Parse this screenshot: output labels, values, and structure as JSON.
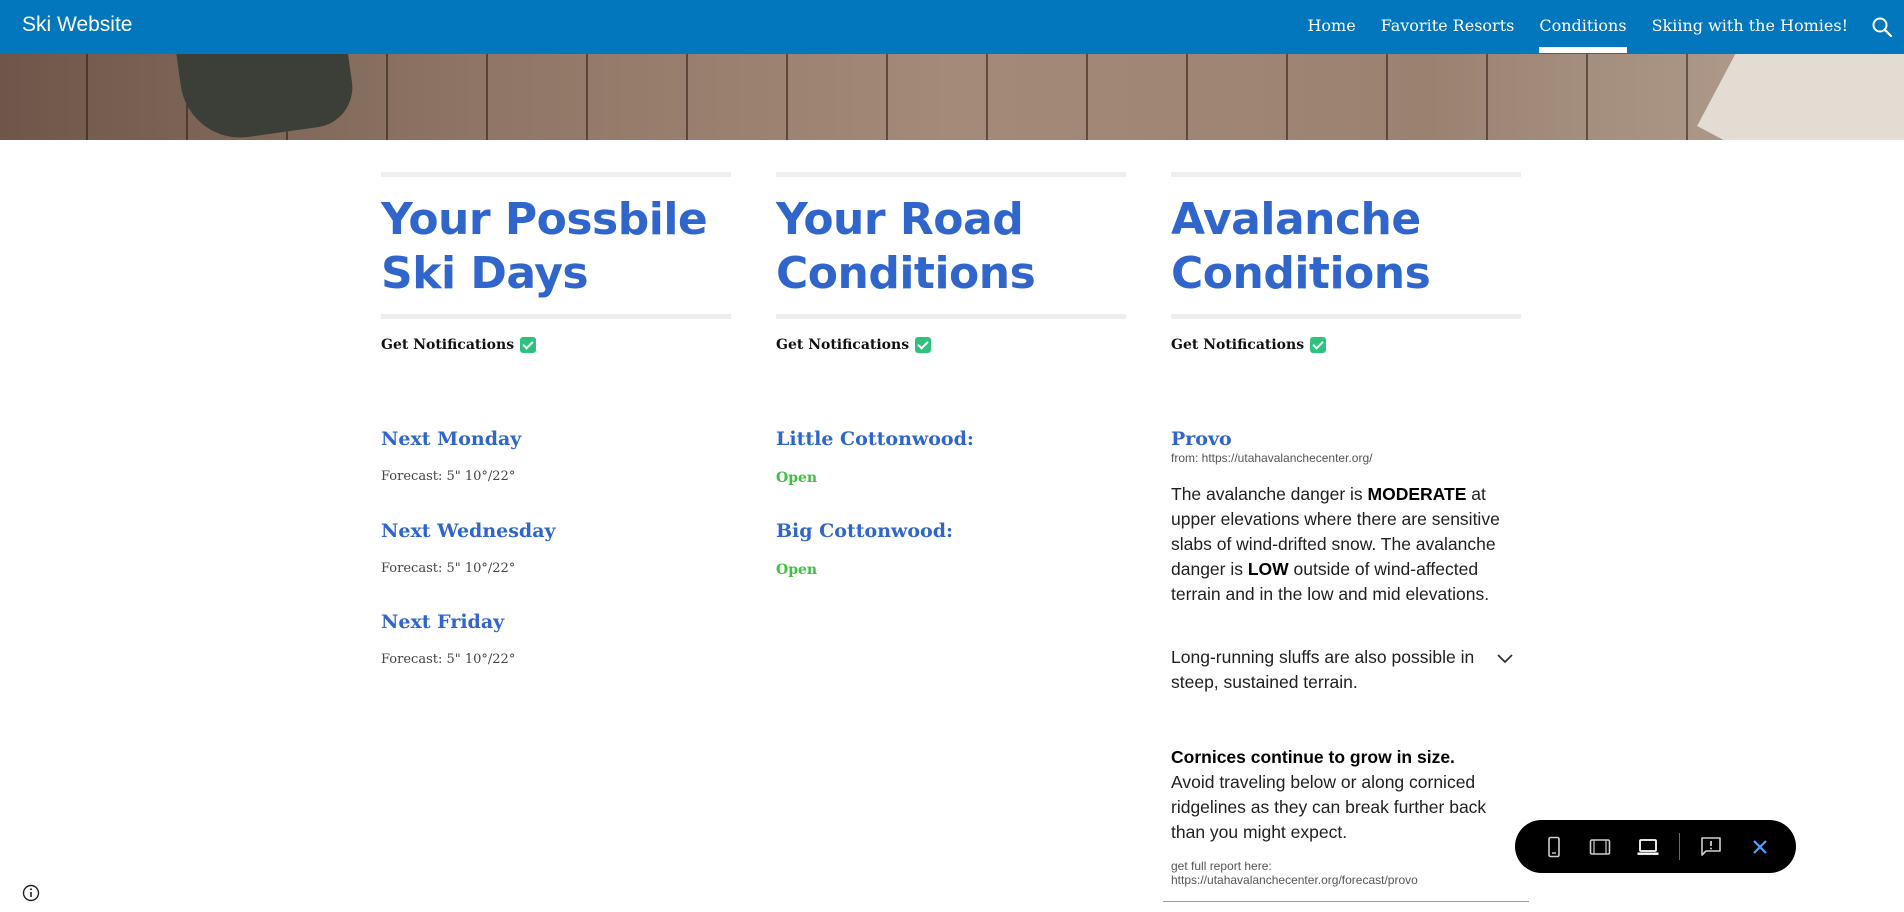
{
  "header": {
    "site_title": "Ski Website",
    "nav": [
      {
        "label": "Home",
        "active": false
      },
      {
        "label": "Favorite Resorts",
        "active": false
      },
      {
        "label": "Conditions",
        "active": true
      },
      {
        "label": "Skiing with the Homies!",
        "active": false
      }
    ],
    "search_icon": "search-icon",
    "bar_color": "#0277bd"
  },
  "columns": {
    "ski_days": {
      "heading_line1": "Your Possbile",
      "heading_line2": "Ski Days",
      "notifications_label": "Get Notifications",
      "items": [
        {
          "day": "Next Monday",
          "forecast": "Forecast: 5\" 10°/22°"
        },
        {
          "day": "Next Wednesday",
          "forecast": "Forecast: 5\" 10°/22°"
        },
        {
          "day": "Next Friday",
          "forecast": "Forecast: 5\" 10°/22°"
        }
      ]
    },
    "roads": {
      "heading_line1": "Your Road",
      "heading_line2": "Conditions",
      "notifications_label": "Get Notifications",
      "items": [
        {
          "road": "Little Cottonwood:",
          "status": "Open"
        },
        {
          "road": "Big Cottonwood:",
          "status": "Open"
        }
      ]
    },
    "avalanche": {
      "heading_line1": "Avalanche",
      "heading_line2": "Conditions",
      "notifications_label": "Get Notifications",
      "region": "Provo",
      "source": "from: https://utahavalanchecenter.org/",
      "p1_part1": "The avalanche danger is ",
      "p1_bold1": "MODERATE",
      "p1_part2": " at upper elevations where there are sensitive slabs of wind-drifted snow. The avalanche danger is ",
      "p1_bold2": "LOW",
      "p1_part3": " outside of wind-affected terrain and in the low and mid elevations.",
      "p2": "Long-running sluffs are also possible in steep, sustained terrain.",
      "p3_bold": "Cornices continue to grow in size.",
      "p3_rest": " Avoid traveling below or along corniced ridgelines as they can break further back than you might expect.",
      "report_label": "get full report here:",
      "report_url": "https://utahavalanchecenter.org/forecast/provo"
    }
  },
  "toolbar": {
    "icons": [
      "phone-preview-icon",
      "tablet-preview-icon",
      "laptop-preview-icon",
      "report-abuse-icon",
      "close-icon"
    ]
  },
  "colors": {
    "heading": "#3066cc",
    "open": "#3ec13e",
    "check": "#2ec27e"
  }
}
